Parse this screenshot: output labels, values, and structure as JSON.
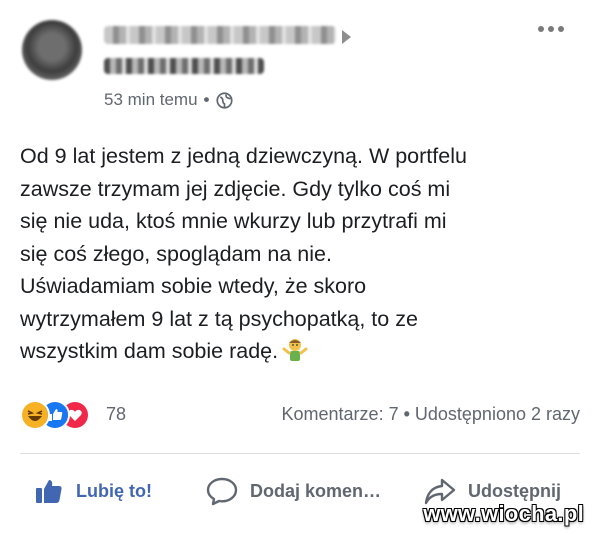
{
  "post": {
    "author_name": "",
    "author_subline": "",
    "time": "53 min temu",
    "time_separator": "•",
    "privacy_icon": "globe-icon",
    "text": "Od 9 lat jestem z jedną dziewczyną. W portfelu\nzawsze trzymam jej zdjęcie. Gdy tylko coś mi\nsię nie uda, ktoś mnie wkurzy lub przytrafi mi\nsię coś złego, spoglądam na nie.\nUświadamiam sobie wtedy, że skoro\nwytrzymałem 9 lat z tą psychopatką, to ze\nwszystkim dam sobie radę.",
    "trailing_emoji": "person-shrugging-icon"
  },
  "reactions": {
    "icons": [
      "haha-icon",
      "like-icon",
      "love-icon"
    ],
    "count": "78",
    "comments": "Komentarze: 7",
    "separator": "•",
    "shares": "Udostępniono 2 razy"
  },
  "actions": {
    "like": "Lubię to!",
    "comment": "Dodaj komen…",
    "share": "Udostępnij"
  },
  "watermark": "www.wiocha.pl",
  "colors": {
    "facebook_blue": "#4267b2",
    "text": "#1c1e21",
    "secondary_text": "#616770",
    "divider": "#dadde1",
    "haha_yellow": "#f7b125",
    "love_red": "#f0284a"
  }
}
